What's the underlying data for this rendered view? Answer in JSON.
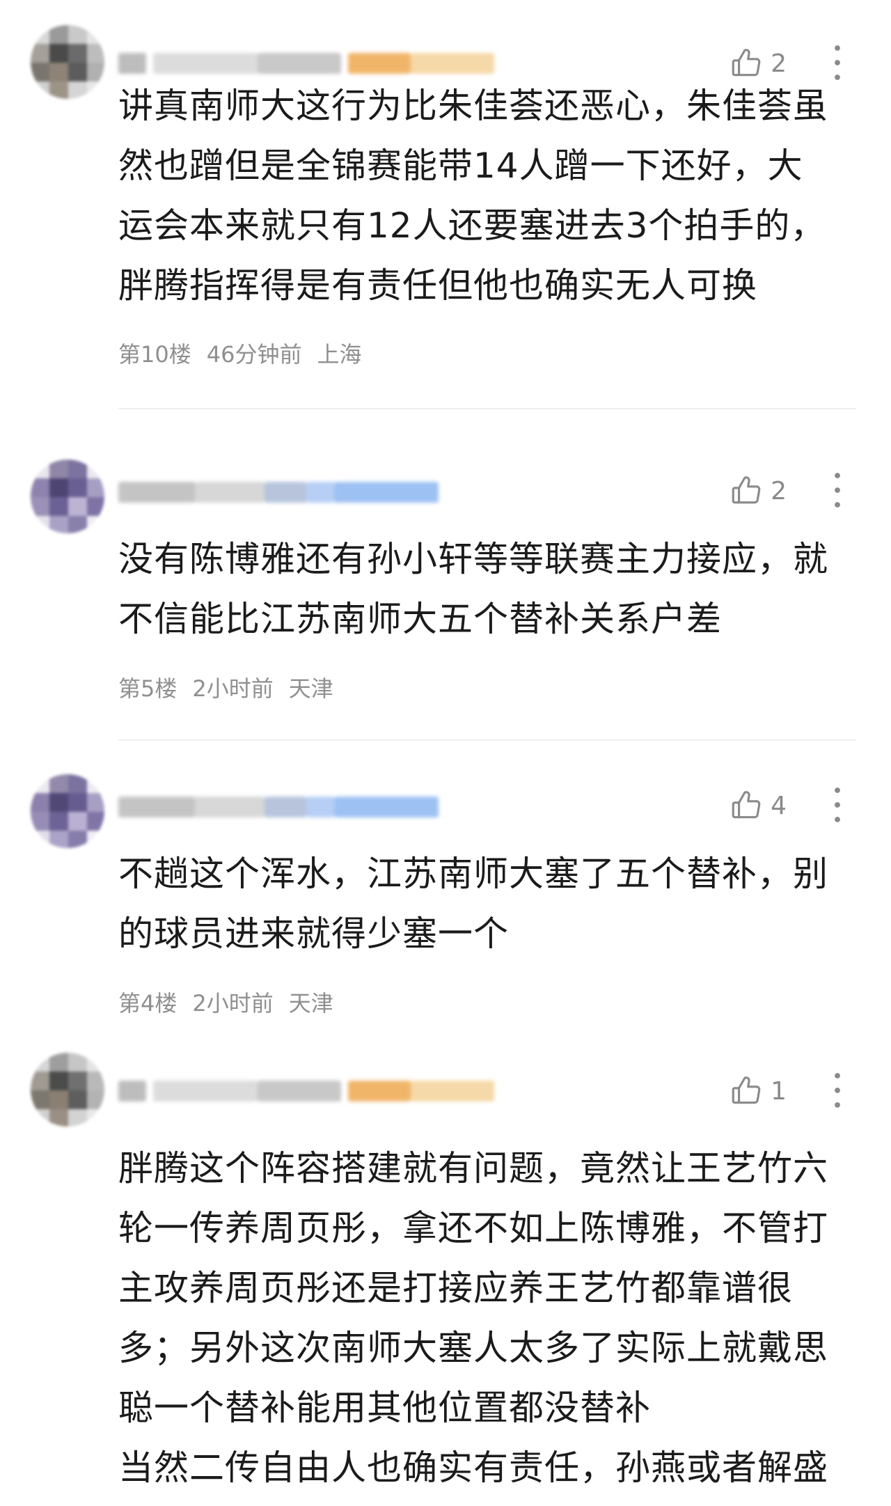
{
  "comments": [
    {
      "likes": "2",
      "text": "讲真南师大这行为比朱佳荟还恶心，朱佳荟虽\n然也蹭但是全锦赛能带14人蹭一下还好，大\n运会本来就只有12人还要塞进去3个拍手的，\n胖腾指挥得是有责任但他也确实无人可换",
      "floor": "第10楼",
      "time": "46分钟前",
      "location": "上海"
    },
    {
      "likes": "2",
      "text": "没有陈博雅还有孙小轩等等联赛主力接应，就\n不信能比江苏南师大五个替补关系户差",
      "floor": "第5楼",
      "time": "2小时前",
      "location": "天津"
    },
    {
      "likes": "4",
      "text": "不趟这个浑水，江苏南师大塞了五个替补，别\n的球员进来就得少塞一个",
      "floor": "第4楼",
      "time": "2小时前",
      "location": "天津"
    },
    {
      "likes": "1",
      "text": "胖腾这个阵容搭建就有问题，竟然让王艺竹六\n轮一传养周页彤，拿还不如上陈博雅，不管打\n主攻养周页彤还是打接应养王艺竹都靠谱很\n多；另外这次南师大塞人太多了实际上就戴思\n聪一个替补能用其他位置都没替补\n当然二传自由人也确实有责任，孙燕或者解盛"
    }
  ],
  "icons": {
    "like": "thumbs-up-outline-icon",
    "more": "more-vertical-icon"
  },
  "colors": {
    "text": "#1b1b1b",
    "meta": "#8f8f8f",
    "icon": "#8a8a8a",
    "divider": "#efefef"
  }
}
